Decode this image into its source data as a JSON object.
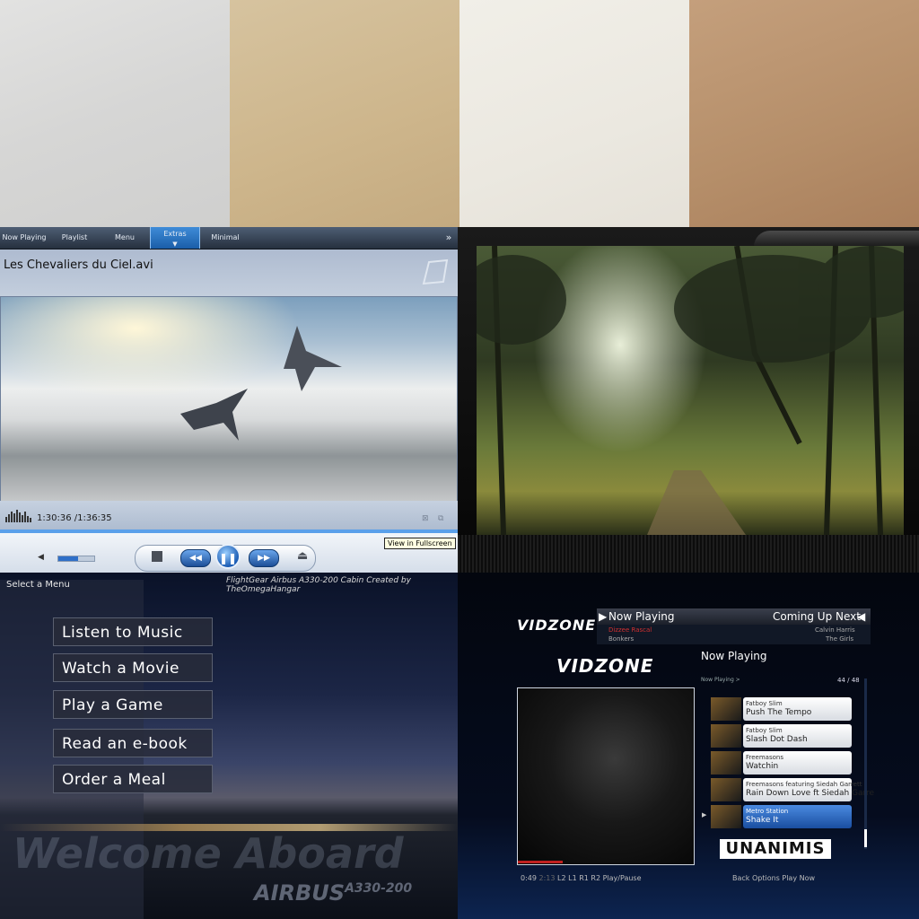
{
  "wmp": {
    "tabs": [
      "Now Playing",
      "Playlist",
      "Menu",
      "Extras",
      "Minimal"
    ],
    "title": "Les Chevaliers du Ciel.avi",
    "time": "1:30:36 /1:36:35",
    "tooltip": "View in Fullscreen",
    "volume": 0.55
  },
  "airbus": {
    "select_label": "Select a Menu",
    "credit": "FlightGear Airbus A330-200 Cabin Created by TheOmegaHangar",
    "menu": [
      "Listen to Music",
      "Watch a Movie",
      "Play a Game",
      "Read an e-book",
      "Order a Meal"
    ],
    "welcome": "Welcome Aboard",
    "brand": "AIRBUS",
    "model": "A330-200"
  },
  "vidzone": {
    "logo": "VIDZONE",
    "now_playing_label": "Now Playing",
    "coming_up_label": "Coming Up Next",
    "np_artist": "Dizzee Rascal",
    "np_song": "Bonkers",
    "next_artist": "Calvin Harris",
    "next_song": "The Girls",
    "list_title": "Now Playing",
    "list_sub": "Now Playing >",
    "count": "44 / 48",
    "tracks": [
      {
        "artist": "Fatboy Slim",
        "song": "Push The Tempo"
      },
      {
        "artist": "Fatboy Slim",
        "song": "Slash Dot Dash"
      },
      {
        "artist": "Freemasons",
        "song": "Watchin"
      },
      {
        "artist": "Freemasons featuring Siedah Garrett",
        "song": "Rain Down Love ft Siedah Garre"
      },
      {
        "artist": "Metro Station",
        "song": "Shake It"
      }
    ],
    "sponsor": "UNANIMIS",
    "footer_time": "0:49",
    "footer_total": "2:13",
    "footer_controls": "L2  L1  R1  R2  Play/Pause",
    "footer_right": "Back   Options   Play Now"
  }
}
